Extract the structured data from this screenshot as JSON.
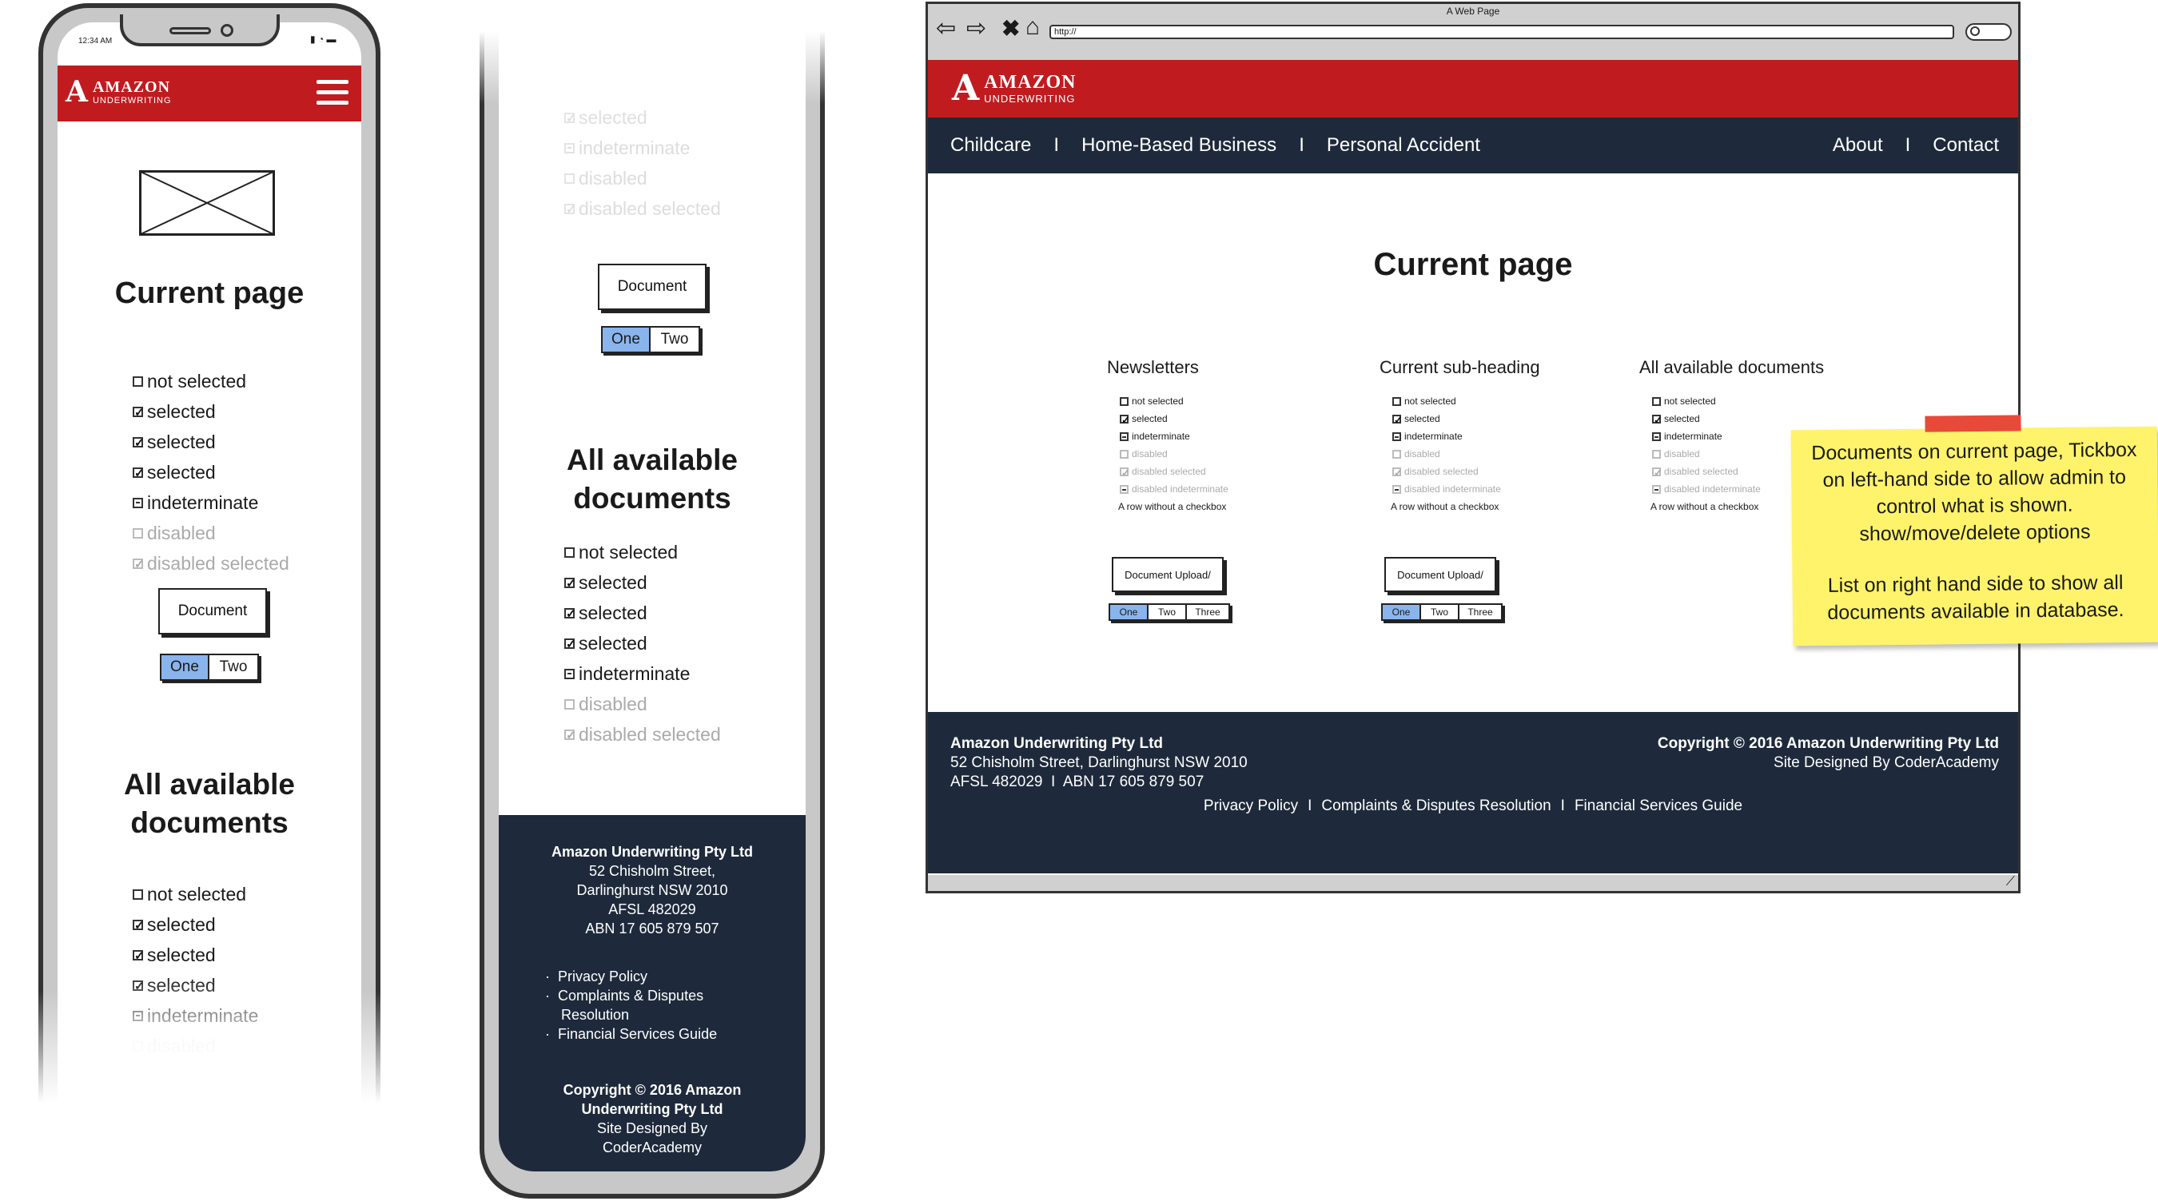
{
  "logo": {
    "big": "AMAZON",
    "small": "UNDERWRITING"
  },
  "phone1": {
    "status_time": "12:34 AM"
  },
  "checkbox_items": [
    {
      "label": "not selected",
      "state": "unchecked"
    },
    {
      "label": "selected",
      "state": "checked"
    },
    {
      "label": "selected",
      "state": "checked"
    },
    {
      "label": "selected",
      "state": "checked"
    },
    {
      "label": "indeterminate",
      "state": "indeterminate"
    },
    {
      "label": "disabled",
      "state": "disabled"
    },
    {
      "label": "disabled selected",
      "state": "disabled-checked"
    }
  ],
  "mobile": {
    "page_title": "Current page",
    "all_docs_heading_1": "All available",
    "all_docs_heading_2": "documents",
    "document_button": "Document",
    "toggle_one": "One",
    "toggle_two": "Two"
  },
  "phone2_top_items": [
    {
      "label": "selected",
      "state": "checked"
    },
    {
      "label": "indeterminate",
      "state": "indeterminate"
    },
    {
      "label": "disabled",
      "state": "disabled"
    },
    {
      "label": "disabled selected",
      "state": "disabled-checked"
    }
  ],
  "mobile_footer": {
    "company": "Amazon Underwriting Pty Ltd",
    "address_line1": "52 Chisholm Street,",
    "address_line2": "Darlinghurst NSW 2010",
    "afsl": "AFSL 482029",
    "abn": "ABN 17 605 879 507",
    "links": [
      "Privacy Policy",
      "Complaints & Disputes",
      "Resolution",
      "Financial Services Guide"
    ],
    "copyright_1": "Copyright © 2016 Amazon",
    "copyright_2": "Underwriting Pty Ltd",
    "designed_1": "Site Designed By",
    "designed_2": "CoderAcademy"
  },
  "browser": {
    "window_title": "A Web Page",
    "url": "http://",
    "nav_left": [
      "Childcare",
      "Home-Based Business",
      "Personal Accident"
    ],
    "nav_right": [
      "About",
      "Contact"
    ],
    "nav_separator": "I",
    "page_title": "Current page",
    "columns": [
      {
        "heading": "Newsletters",
        "has_controls": true
      },
      {
        "heading": "Current sub-heading",
        "has_controls": true
      },
      {
        "heading": "All available documents",
        "has_controls": false
      }
    ],
    "desktop_checkbox_items": [
      {
        "label": "not selected",
        "state": "unchecked"
      },
      {
        "label": "selected",
        "state": "checked"
      },
      {
        "label": "indeterminate",
        "state": "indeterminate"
      },
      {
        "label": "disabled",
        "state": "disabled"
      },
      {
        "label": "disabled selected",
        "state": "disabled-checked"
      },
      {
        "label": "disabled indeterminate",
        "state": "disabled-indeterminate"
      },
      {
        "label": "A row without a checkbox",
        "state": "none"
      }
    ],
    "upload_button": "Document Upload/",
    "seg_labels": [
      "One",
      "Two",
      "Three"
    ],
    "footer": {
      "company": "Amazon Underwriting Pty Ltd",
      "address": "52 Chisholm Street, Darlinghurst NSW 2010",
      "afsl_abn": "AFSL 482029  I  ABN 17 605 879 507",
      "copyright": "Copyright © 2016 Amazon Underwriting Pty Ltd",
      "designed": "Site Designed By CoderAcademy",
      "links": [
        "Privacy Policy",
        "Complaints & Disputes Resolution",
        "Financial Services Guide"
      ],
      "link_separator": "I"
    }
  },
  "sticky_note": {
    "para1": "Documents on current page, Tickbox on left-hand side to allow admin to control what is shown. show/move/delete options",
    "para2": "List on right hand side to show all documents available in database."
  },
  "colors": {
    "brand_red": "#c01c20",
    "navy": "#1e2a3b",
    "toggle_blue": "#8ab4ec",
    "sticky": "#fff36b"
  }
}
